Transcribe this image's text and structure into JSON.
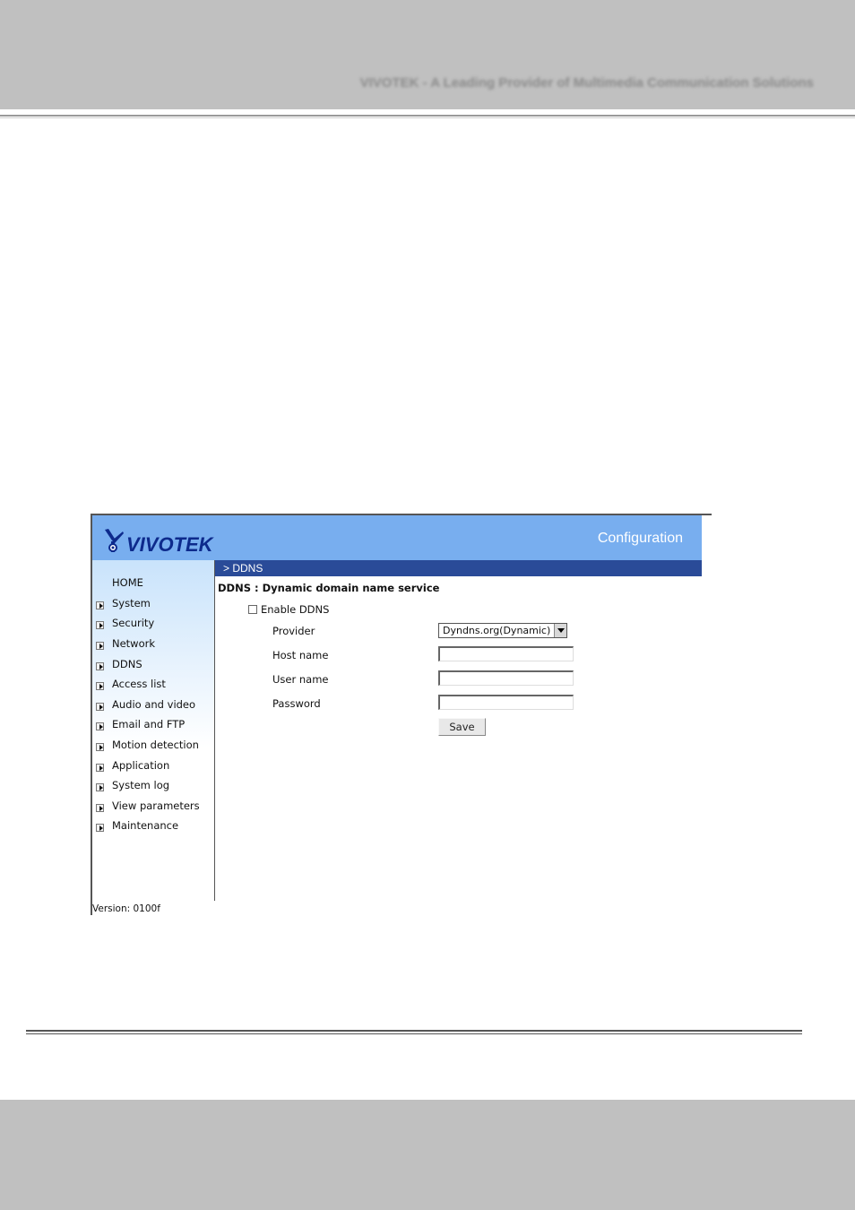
{
  "page": {
    "header_tagline": "VIVOTEK - A Leading Provider of Multimedia Communication Solutions"
  },
  "app": {
    "logo_text": "VIVOTEK",
    "config_title": "Configuration",
    "breadcrumb": "> DDNS",
    "version": "Version: 0100f"
  },
  "sidebar": {
    "items": [
      {
        "label": "HOME",
        "arrow": false
      },
      {
        "label": "System",
        "arrow": true
      },
      {
        "label": "Security",
        "arrow": true
      },
      {
        "label": "Network",
        "arrow": true
      },
      {
        "label": "DDNS",
        "arrow": true
      },
      {
        "label": "Access list",
        "arrow": true
      },
      {
        "label": "Audio and video",
        "arrow": true
      },
      {
        "label": "Email and FTP",
        "arrow": true
      },
      {
        "label": "Motion detection",
        "arrow": true
      },
      {
        "label": "Application",
        "arrow": true
      },
      {
        "label": "System log",
        "arrow": true
      },
      {
        "label": "View parameters",
        "arrow": true
      },
      {
        "label": "Maintenance",
        "arrow": true
      }
    ]
  },
  "form": {
    "section_title": "DDNS : Dynamic domain name service",
    "enable_label": "Enable DDNS",
    "enable_checked": false,
    "provider_label": "Provider",
    "provider_value": "Dyndns.org(Dynamic)",
    "hostname_label": "Host name",
    "hostname_value": "",
    "username_label": "User name",
    "username_value": "",
    "password_label": "Password",
    "password_value": "",
    "save_label": "Save"
  },
  "colors": {
    "header_bg": "#78aeef",
    "breadcrumb_bg": "#2a4b98",
    "page_band": "#c0c0c0"
  }
}
